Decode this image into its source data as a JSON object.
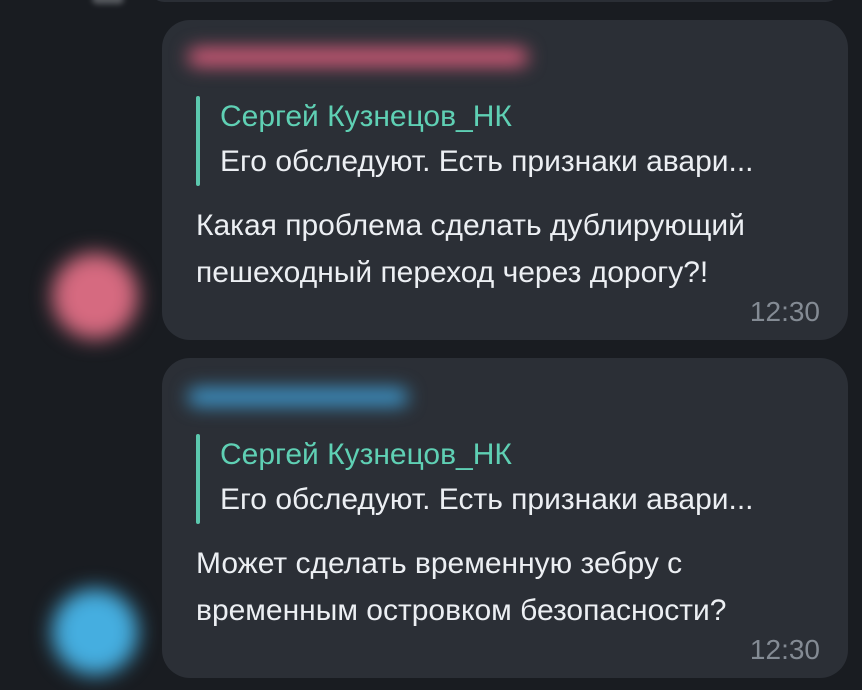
{
  "colors": {
    "background": "#191c21",
    "bubble": "#2b2f36",
    "accent": "#5fd0b4",
    "text": "#eceff3",
    "time": "#848b94"
  },
  "messages": [
    {
      "avatar_color": "#d66a80",
      "sender_color": "#d55c7a",
      "sender_name": "",
      "reply": {
        "author": "Сергей Кузнецов_НК",
        "text": "Его обследуют. Есть признаки авари..."
      },
      "text": "Какая проблема сделать дублирующий пешеходный переход через дорогу?!",
      "time": "12:30"
    },
    {
      "avatar_color": "#45aee0",
      "sender_color": "#3e95c8",
      "sender_name": "",
      "reply": {
        "author": "Сергей Кузнецов_НК",
        "text": "Его обследуют. Есть признаки авари..."
      },
      "text": "Может сделать временную зебру с временным островком безопасности?",
      "time": "12:30"
    }
  ]
}
